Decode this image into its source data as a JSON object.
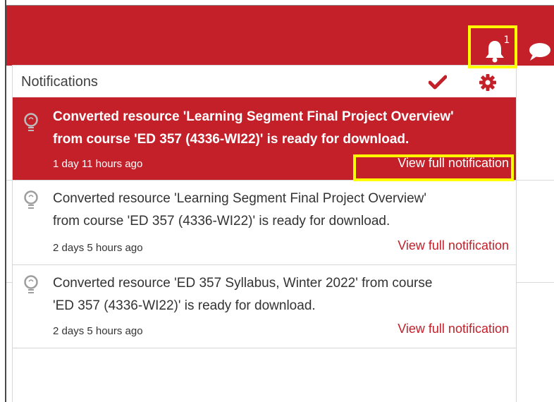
{
  "colors": {
    "brand": "#c4202a",
    "highlight": "#ffff00",
    "text": "#333333",
    "white": "#ffffff"
  },
  "header": {
    "bell_icon": "bell-icon",
    "notification_count": "1",
    "chat_icon": "chat-bubble-icon"
  },
  "notifications_panel": {
    "title": "Notifications",
    "mark_all_read_icon": "checkmark-icon",
    "settings_icon": "gear-icon",
    "items": [
      {
        "icon": "lightbulb-icon",
        "message_line1": "Converted resource 'Learning Segment Final Project Overview'",
        "message_line2": "from course 'ED 357 (4336-WI22)' is ready for download.",
        "time": "1 day 11 hours ago",
        "link": "View full notification",
        "unread": true
      },
      {
        "icon": "lightbulb-icon",
        "message_line1": "Converted resource 'Learning Segment Final Project Overview'",
        "message_line2": "from course 'ED 357 (4336-WI22)' is ready for download.",
        "time": "2 days 5 hours ago",
        "link": "View full notification",
        "unread": false
      },
      {
        "icon": "lightbulb-icon",
        "message_line1": "Converted resource 'ED 357 Syllabus, Winter 2022' from course",
        "message_line2": "'ED 357 (4336-WI22)' is ready for download.",
        "time": "2 days 5 hours ago",
        "link": "View full notification",
        "unread": false
      }
    ]
  }
}
